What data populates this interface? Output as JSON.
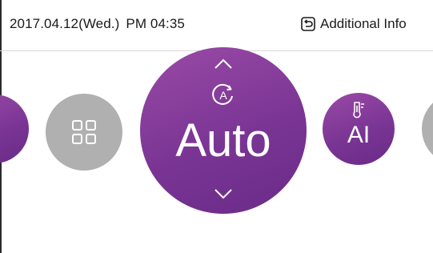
{
  "status_bar": {
    "date": "2017.04.12(Wed.)",
    "time": "PM 04:35",
    "additional_info_label": "Additional Info"
  },
  "mode_selector": {
    "current_mode": "Auto",
    "mode_icon": "auto-mode-icon",
    "next_mode_label": "AI",
    "next_mode_icon": "thermometer-icon",
    "menu_icon": "grid-icon"
  },
  "colors": {
    "accent": "#7a3594",
    "inactive": "#b0b0b0",
    "text": "#1a1a1a"
  }
}
